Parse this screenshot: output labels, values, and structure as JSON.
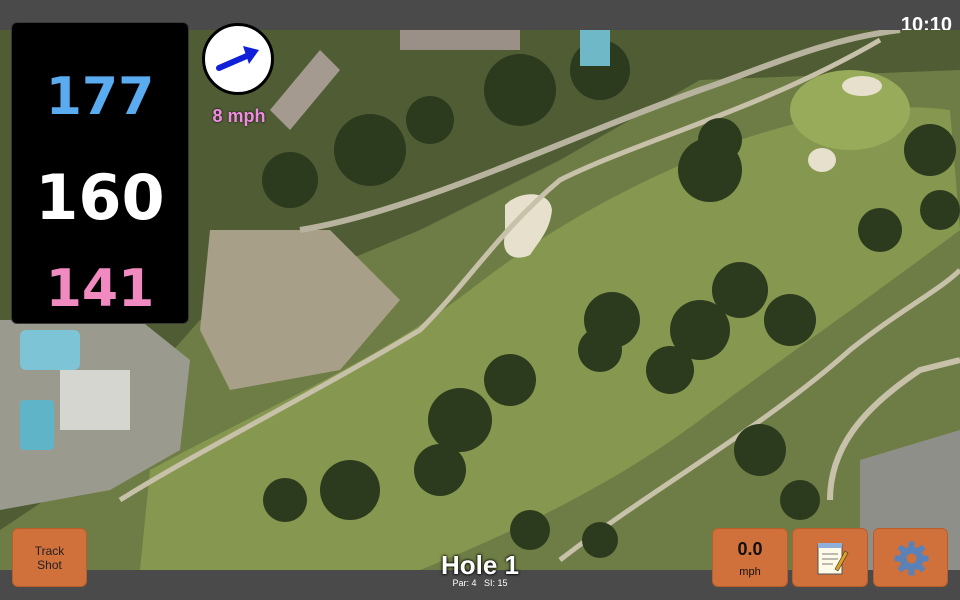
{
  "status": {
    "clock": "10:10"
  },
  "yardages": {
    "back": "177",
    "middle": "160",
    "front": "141"
  },
  "wind": {
    "speed": "8 mph",
    "arrow_icon": "arrow-right-icon"
  },
  "hole": {
    "title": "Hole 1",
    "par": "Par: 4",
    "stroke_index": "SI: 15"
  },
  "buttons": {
    "track_shot": "Track\nShot",
    "speed_value": "0.0",
    "speed_unit": "mph",
    "notes_icon": "notepad-icon",
    "settings_icon": "gear-icon"
  },
  "colors": {
    "back": "#5aabef",
    "middle": "#ffffff",
    "front": "#f08ac0",
    "wind_text": "#f08ce0",
    "button": "#d0703a"
  }
}
